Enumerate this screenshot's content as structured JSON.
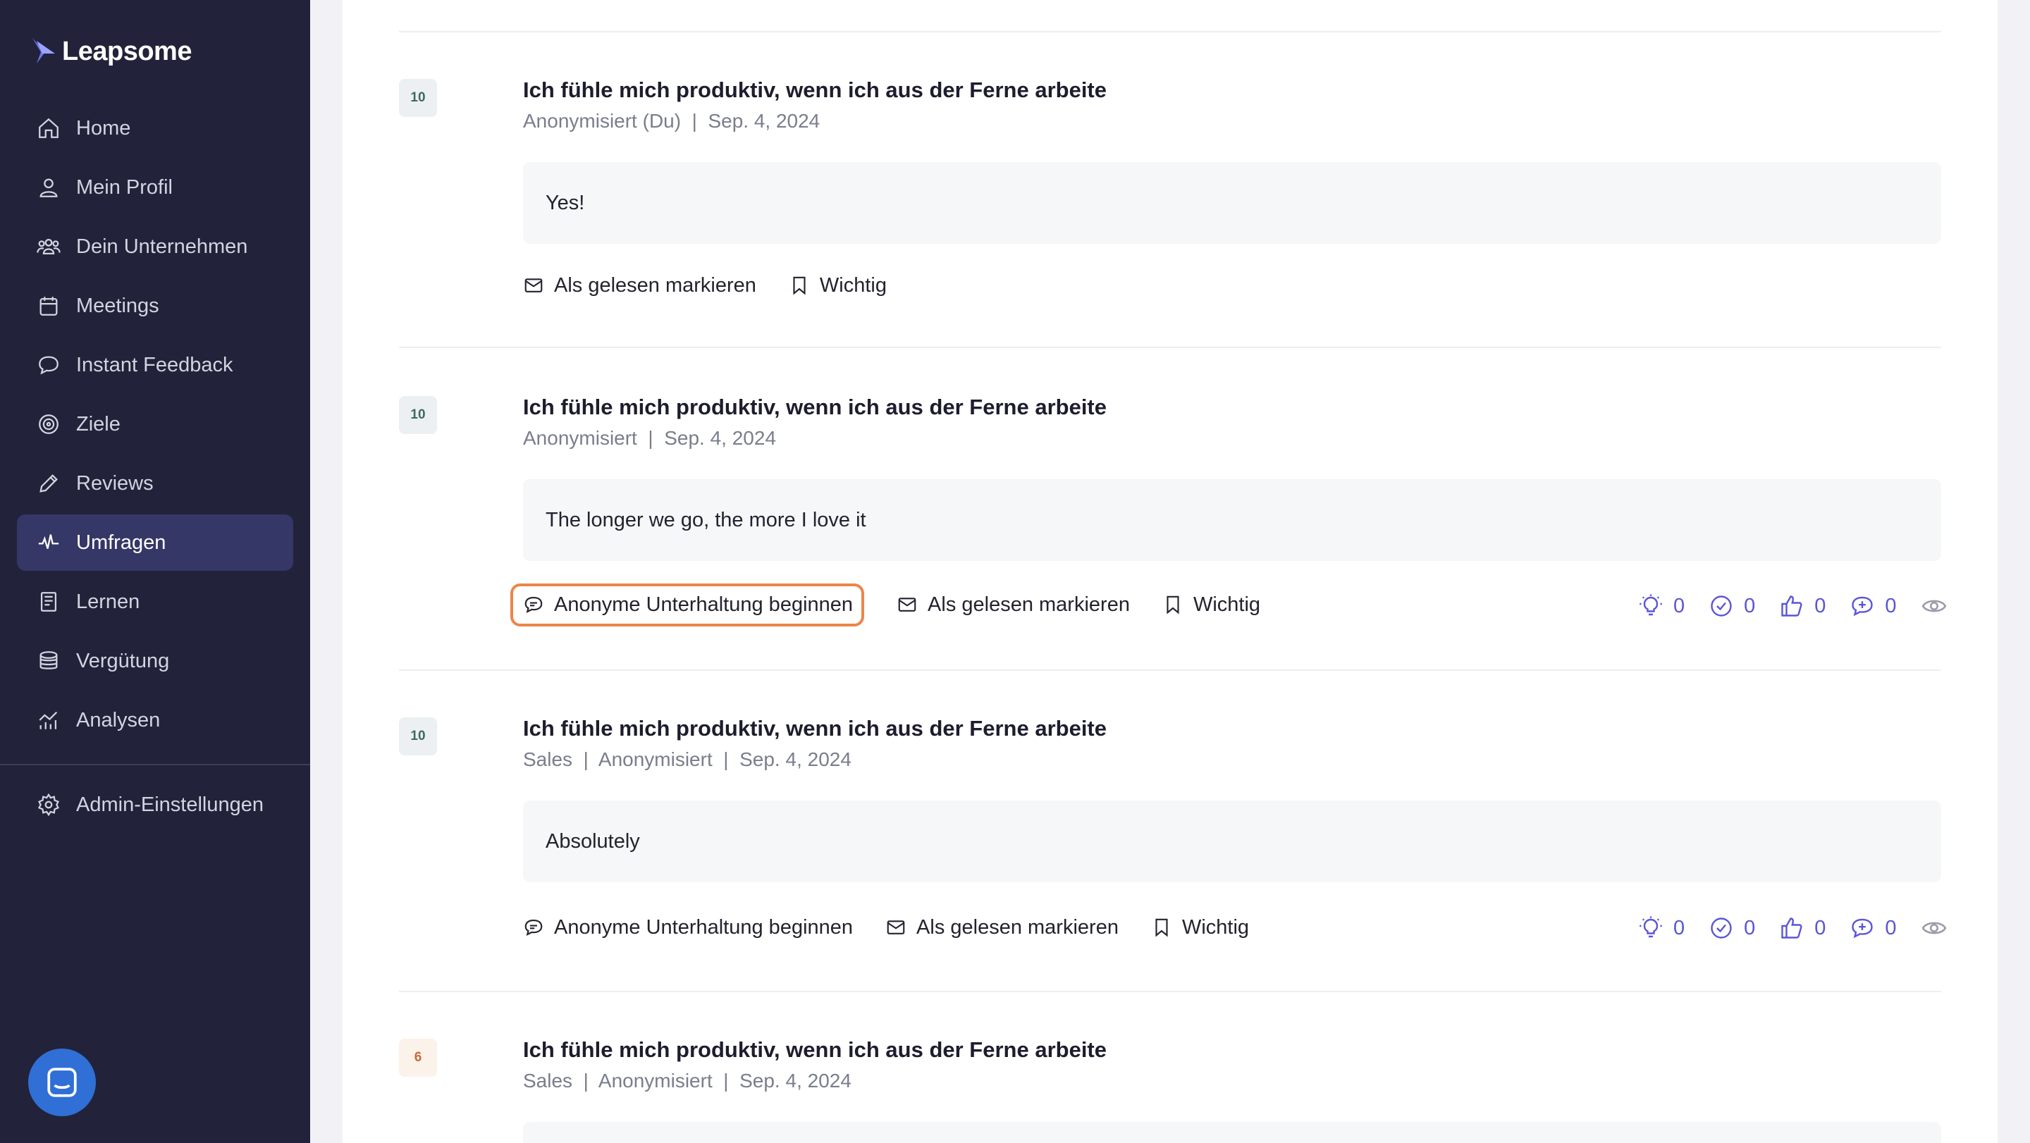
{
  "app": {
    "name": "Leapsome"
  },
  "sidebar": {
    "items": [
      {
        "label": "Home",
        "icon": "home-icon"
      },
      {
        "label": "Mein Profil",
        "icon": "user-icon"
      },
      {
        "label": "Dein Unternehmen",
        "icon": "users-icon"
      },
      {
        "label": "Meetings",
        "icon": "calendar-icon"
      },
      {
        "label": "Instant Feedback",
        "icon": "chat-icon"
      },
      {
        "label": "Ziele",
        "icon": "target-icon"
      },
      {
        "label": "Reviews",
        "icon": "pencil-icon"
      },
      {
        "label": "Umfragen",
        "icon": "pulse-icon",
        "active": true
      },
      {
        "label": "Lernen",
        "icon": "book-icon"
      },
      {
        "label": "Vergütung",
        "icon": "coins-icon"
      },
      {
        "label": "Analysen",
        "icon": "analytics-icon"
      }
    ],
    "admin": {
      "label": "Admin-Einstellungen",
      "icon": "gear-icon"
    }
  },
  "actions": {
    "start_anonymous": "Anonyme Unterhaltung beginnen",
    "mark_read": "Als gelesen markieren",
    "important": "Wichtig"
  },
  "entries": [
    {
      "score": "10",
      "title": "Ich fühle mich produktiv, wenn ich aus der Ferne arbeite",
      "meta": "Anonymisiert (Du)  |  Sep. 4, 2024",
      "answer": "Yes!",
      "reactions": null
    },
    {
      "score": "10",
      "title": "Ich fühle mich produktiv, wenn ich aus der Ferne arbeite",
      "meta": "Anonymisiert  |  Sep. 4, 2024",
      "answer": "The longer we go, the more I love it",
      "reactions": {
        "idea": "0",
        "check": "0",
        "like": "0",
        "comment": "0"
      }
    },
    {
      "score": "10",
      "title": "Ich fühle mich produktiv, wenn ich aus der Ferne arbeite",
      "meta": "Sales  |  Anonymisiert  |  Sep. 4, 2024",
      "answer": "Absolutely",
      "reactions": {
        "idea": "0",
        "check": "0",
        "like": "0",
        "comment": "0"
      }
    },
    {
      "score": "6",
      "title": "Ich fühle mich produktiv, wenn ich aus der Ferne arbeite",
      "meta": "Sales  |  Anonymisiert  |  Sep. 4, 2024",
      "answer": "",
      "reactions": null
    }
  ],
  "colors": {
    "sidebar_bg": "#22223a",
    "active_item": "#353766",
    "accent": "#5a55d6",
    "highlight_border": "#ec8549",
    "help_button": "#2f6fd6"
  }
}
